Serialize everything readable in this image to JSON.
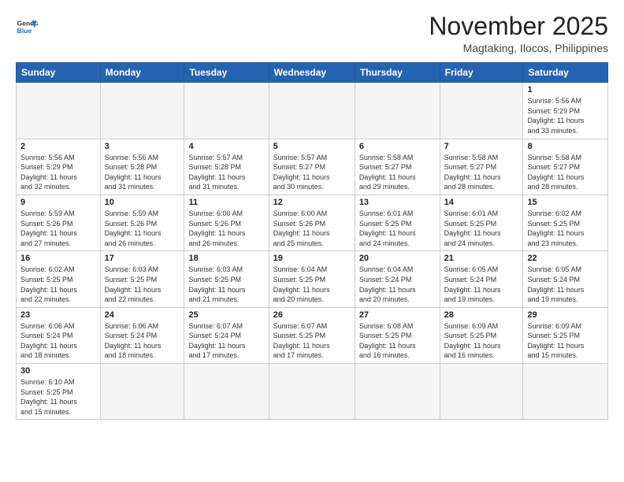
{
  "header": {
    "logo_general": "General",
    "logo_blue": "Blue",
    "month_title": "November 2025",
    "location": "Magtaking, Ilocos, Philippines"
  },
  "weekdays": [
    "Sunday",
    "Monday",
    "Tuesday",
    "Wednesday",
    "Thursday",
    "Friday",
    "Saturday"
  ],
  "weeks": [
    [
      {
        "day": "",
        "info": ""
      },
      {
        "day": "",
        "info": ""
      },
      {
        "day": "",
        "info": ""
      },
      {
        "day": "",
        "info": ""
      },
      {
        "day": "",
        "info": ""
      },
      {
        "day": "",
        "info": ""
      },
      {
        "day": "1",
        "info": "Sunrise: 5:56 AM\nSunset: 5:29 PM\nDaylight: 11 hours\nand 33 minutes."
      }
    ],
    [
      {
        "day": "2",
        "info": "Sunrise: 5:56 AM\nSunset: 5:29 PM\nDaylight: 11 hours\nand 32 minutes."
      },
      {
        "day": "3",
        "info": "Sunrise: 5:56 AM\nSunset: 5:28 PM\nDaylight: 11 hours\nand 31 minutes."
      },
      {
        "day": "4",
        "info": "Sunrise: 5:57 AM\nSunset: 5:28 PM\nDaylight: 11 hours\nand 31 minutes."
      },
      {
        "day": "5",
        "info": "Sunrise: 5:57 AM\nSunset: 5:27 PM\nDaylight: 11 hours\nand 30 minutes."
      },
      {
        "day": "6",
        "info": "Sunrise: 5:58 AM\nSunset: 5:27 PM\nDaylight: 11 hours\nand 29 minutes."
      },
      {
        "day": "7",
        "info": "Sunrise: 5:58 AM\nSunset: 5:27 PM\nDaylight: 11 hours\nand 28 minutes."
      },
      {
        "day": "8",
        "info": "Sunrise: 5:58 AM\nSunset: 5:27 PM\nDaylight: 11 hours\nand 28 minutes."
      }
    ],
    [
      {
        "day": "9",
        "info": "Sunrise: 5:59 AM\nSunset: 5:26 PM\nDaylight: 11 hours\nand 27 minutes."
      },
      {
        "day": "10",
        "info": "Sunrise: 5:59 AM\nSunset: 5:26 PM\nDaylight: 11 hours\nand 26 minutes."
      },
      {
        "day": "11",
        "info": "Sunrise: 6:00 AM\nSunset: 5:26 PM\nDaylight: 11 hours\nand 26 minutes."
      },
      {
        "day": "12",
        "info": "Sunrise: 6:00 AM\nSunset: 5:26 PM\nDaylight: 11 hours\nand 25 minutes."
      },
      {
        "day": "13",
        "info": "Sunrise: 6:01 AM\nSunset: 5:25 PM\nDaylight: 11 hours\nand 24 minutes."
      },
      {
        "day": "14",
        "info": "Sunrise: 6:01 AM\nSunset: 5:25 PM\nDaylight: 11 hours\nand 24 minutes."
      },
      {
        "day": "15",
        "info": "Sunrise: 6:02 AM\nSunset: 5:25 PM\nDaylight: 11 hours\nand 23 minutes."
      }
    ],
    [
      {
        "day": "16",
        "info": "Sunrise: 6:02 AM\nSunset: 5:25 PM\nDaylight: 11 hours\nand 22 minutes."
      },
      {
        "day": "17",
        "info": "Sunrise: 6:03 AM\nSunset: 5:25 PM\nDaylight: 11 hours\nand 22 minutes."
      },
      {
        "day": "18",
        "info": "Sunrise: 6:03 AM\nSunset: 5:25 PM\nDaylight: 11 hours\nand 21 minutes."
      },
      {
        "day": "19",
        "info": "Sunrise: 6:04 AM\nSunset: 5:25 PM\nDaylight: 11 hours\nand 20 minutes."
      },
      {
        "day": "20",
        "info": "Sunrise: 6:04 AM\nSunset: 5:24 PM\nDaylight: 11 hours\nand 20 minutes."
      },
      {
        "day": "21",
        "info": "Sunrise: 6:05 AM\nSunset: 5:24 PM\nDaylight: 11 hours\nand 19 minutes."
      },
      {
        "day": "22",
        "info": "Sunrise: 6:05 AM\nSunset: 5:24 PM\nDaylight: 11 hours\nand 19 minutes."
      }
    ],
    [
      {
        "day": "23",
        "info": "Sunrise: 6:06 AM\nSunset: 5:24 PM\nDaylight: 11 hours\nand 18 minutes."
      },
      {
        "day": "24",
        "info": "Sunrise: 6:06 AM\nSunset: 5:24 PM\nDaylight: 11 hours\nand 18 minutes."
      },
      {
        "day": "25",
        "info": "Sunrise: 6:07 AM\nSunset: 5:24 PM\nDaylight: 11 hours\nand 17 minutes."
      },
      {
        "day": "26",
        "info": "Sunrise: 6:07 AM\nSunset: 5:25 PM\nDaylight: 11 hours\nand 17 minutes."
      },
      {
        "day": "27",
        "info": "Sunrise: 6:08 AM\nSunset: 5:25 PM\nDaylight: 11 hours\nand 16 minutes."
      },
      {
        "day": "28",
        "info": "Sunrise: 6:09 AM\nSunset: 5:25 PM\nDaylight: 11 hours\nand 16 minutes."
      },
      {
        "day": "29",
        "info": "Sunrise: 6:09 AM\nSunset: 5:25 PM\nDaylight: 11 hours\nand 15 minutes."
      }
    ],
    [
      {
        "day": "30",
        "info": "Sunrise: 6:10 AM\nSunset: 5:25 PM\nDaylight: 11 hours\nand 15 minutes."
      },
      {
        "day": "",
        "info": ""
      },
      {
        "day": "",
        "info": ""
      },
      {
        "day": "",
        "info": ""
      },
      {
        "day": "",
        "info": ""
      },
      {
        "day": "",
        "info": ""
      },
      {
        "day": "",
        "info": ""
      }
    ]
  ]
}
